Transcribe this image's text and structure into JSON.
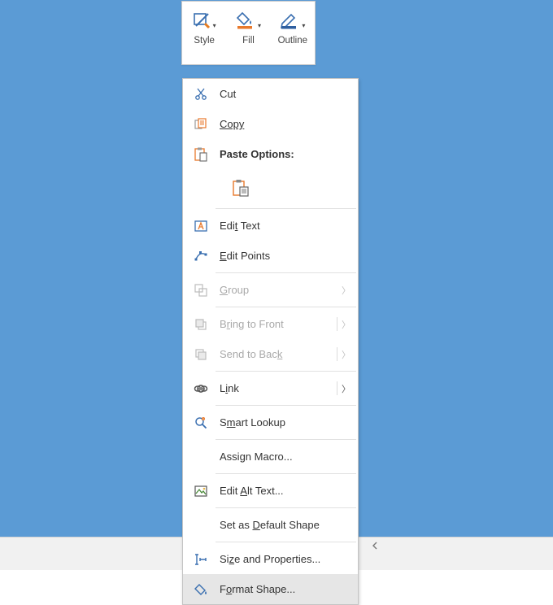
{
  "ribbon": {
    "style": {
      "label": "Style"
    },
    "fill": {
      "label": "Fill"
    },
    "outline": {
      "label": "Outline"
    }
  },
  "ctx": {
    "cut": "Cut",
    "copy": "Copy",
    "paste_options": "Paste Options:",
    "edit_text_pre": "Edi",
    "edit_text_u": "t",
    "edit_text_post": " Text",
    "edit_points_pre": "",
    "edit_points_u": "E",
    "edit_points_post": "dit Points",
    "group_u": "G",
    "group_post": "roup",
    "bring_front_pre": "B",
    "bring_front_u": "r",
    "bring_front_post": "ing to Front",
    "send_back_pre": "Send to Bac",
    "send_back_u": "k",
    "link_pre": "L",
    "link_u": "i",
    "link_post": "nk",
    "smart_pre": "S",
    "smart_u": "m",
    "smart_post": "art Lookup",
    "assign_pre": "Assi",
    "assign_u": "g",
    "assign_post": "n Macro...",
    "alt_pre": "Edit ",
    "alt_u": "A",
    "alt_post": "lt Text...",
    "default_pre": "Set as ",
    "default_u": "D",
    "default_post": "efault Shape",
    "size_pre": "Si",
    "size_u": "z",
    "size_post": "e and Properties...",
    "format_pre": "F",
    "format_u": "o",
    "format_post": "rmat Shape..."
  }
}
